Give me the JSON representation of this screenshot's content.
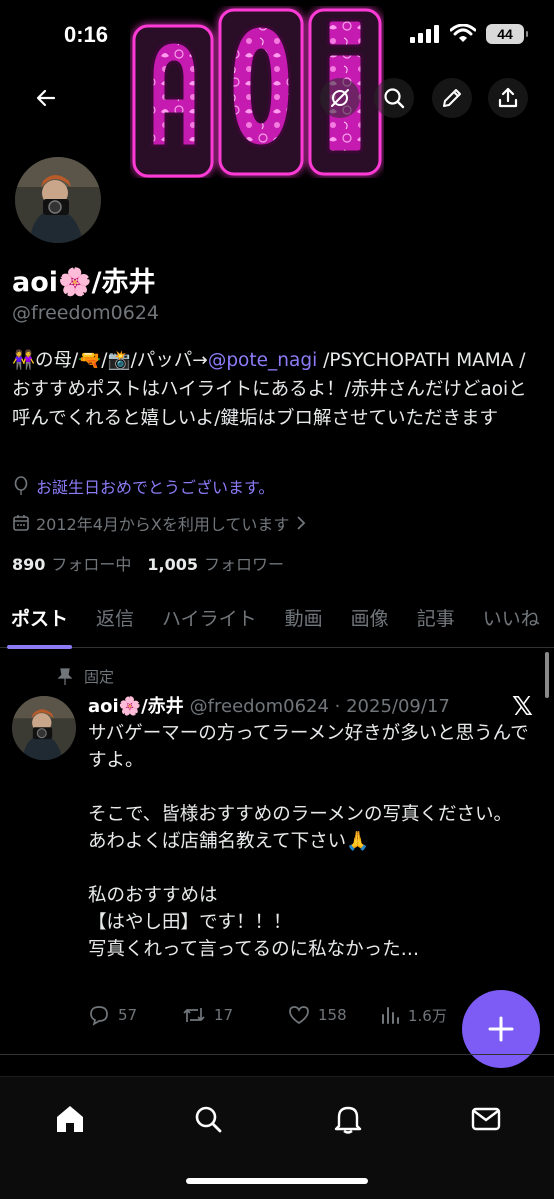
{
  "status": {
    "time": "0:16",
    "battery": "44"
  },
  "banner": {
    "logo_text": "aoi",
    "colors": {
      "pink": "#e020c8",
      "magenta": "#ff3ad6"
    }
  },
  "topbar": {
    "back_icon": "arrow-left-icon",
    "grok_icon": "grok-icon",
    "search_icon": "search-icon",
    "compose_icon": "pencil-icon",
    "share_icon": "share-icon"
  },
  "profile": {
    "name": "aoi🌸/赤井",
    "handle": "@freedom0624",
    "bio_prefix": "👭の母/🔫/📸/パッパ→",
    "bio_mention": "@pote_nagi",
    "bio_suffix": " /PSYCHOPATH MAMA /おすすめポストはハイライトにあるよ！/赤井さんだけどaoiと呼んでくれると嬉しいよ/鍵垢はブロ解させていただきます",
    "birthday": "お誕生日おめでとうございます。",
    "joined": "2012年4月からXを利用しています",
    "following_count": "890",
    "following_label": "フォロー中",
    "followers_count": "1,005",
    "followers_label": "フォロワー"
  },
  "tabs": [
    "ポスト",
    "返信",
    "ハイライト",
    "動画",
    "画像",
    "記事",
    "いいね"
  ],
  "active_tab": 0,
  "post": {
    "pinned_label": "固定",
    "author_name": "aoi🌸/赤井",
    "meta": "@freedom0624 · 2025/09/17",
    "body": "サバゲーマーの方ってラーメン好きが多いと思うんですよ。\n\nそこで、皆様おすすめのラーメンの写真ください。\nあわよくば店舗名教えて下さい🙏\n\n私のおすすめは\n【はやし田】です！！！\n写真くれって言ってるのに私なかった…",
    "replies": "57",
    "reposts": "17",
    "likes": "158",
    "views": "1.6万"
  },
  "accent_color": "#8b7cf6",
  "fab_icon": "plus-icon",
  "nav": [
    "home-icon",
    "search-icon",
    "bell-icon",
    "mail-icon"
  ]
}
